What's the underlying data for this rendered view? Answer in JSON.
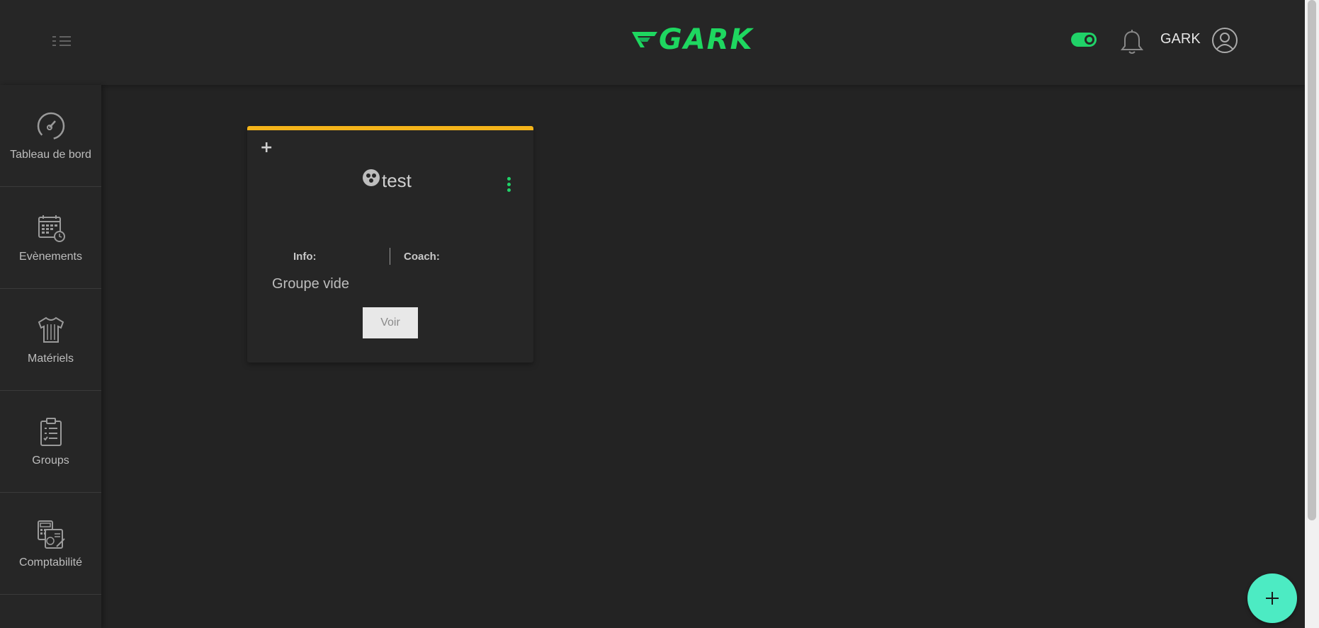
{
  "header": {
    "logo_text": "GARK",
    "username": "GARK",
    "brand_color": "#1ed760",
    "theme_toggle_on": true
  },
  "sidebar": {
    "items": [
      {
        "label": "Tableau de bord",
        "icon": "speedometer-icon"
      },
      {
        "label": "Evènements",
        "icon": "calendar-clock-icon"
      },
      {
        "label": "Matériels",
        "icon": "jersey-icon"
      },
      {
        "label": "Groups",
        "icon": "clipboard-list-icon"
      },
      {
        "label": "Comptabilité",
        "icon": "accounting-icon"
      }
    ]
  },
  "group_card": {
    "accent_color": "#f4b41a",
    "add_symbol": "+",
    "title": "test",
    "info_label": "Info:",
    "coach_label": "Coach:",
    "empty_text": "Groupe vide",
    "view_button_label": "Voir"
  },
  "fab": {
    "symbol": "+",
    "color": "#4cebc3"
  }
}
